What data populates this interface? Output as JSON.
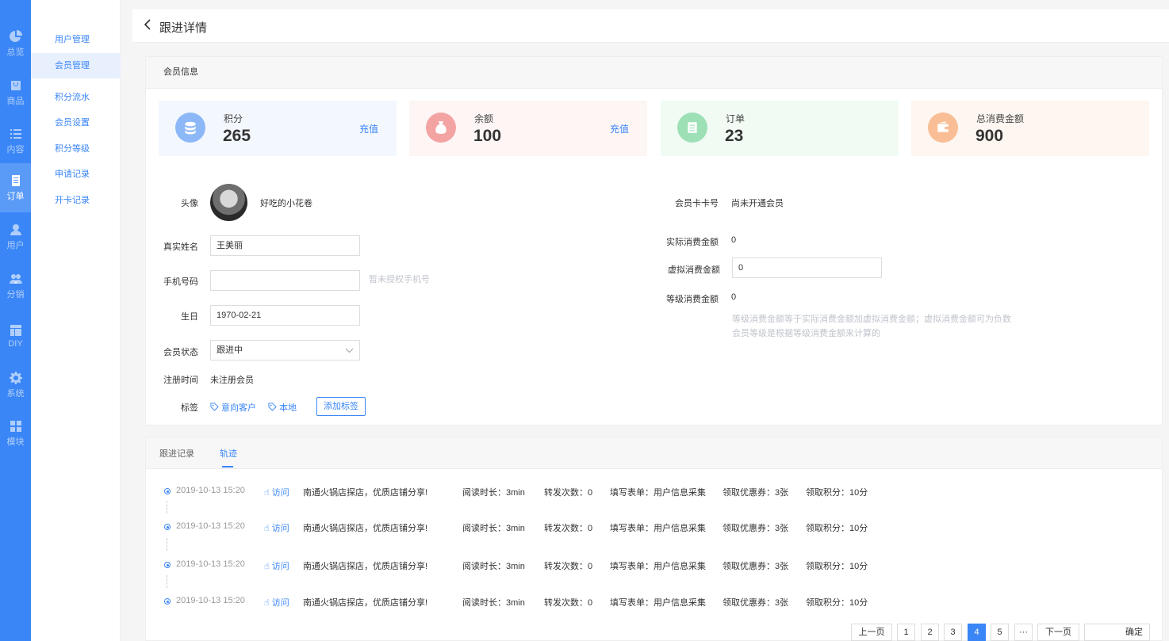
{
  "rail": [
    {
      "label": "总览",
      "icon": "pie-chart-icon"
    },
    {
      "label": "商品",
      "icon": "bag-icon"
    },
    {
      "label": "内容",
      "icon": "list-icon"
    },
    {
      "label": "订单",
      "icon": "document-icon"
    },
    {
      "label": "用户",
      "icon": "user-icon"
    },
    {
      "label": "分销",
      "icon": "group-icon"
    },
    {
      "label": "DIY",
      "icon": "layout-icon"
    },
    {
      "label": "系统",
      "icon": "gear-icon"
    },
    {
      "label": "模块",
      "icon": "grid-icon"
    }
  ],
  "subnav": [
    "用户管理",
    "会员管理",
    "积分流水",
    "会员设置",
    "积分等级",
    "申请记录",
    "开卡记录"
  ],
  "header": {
    "title": "跟进详情"
  },
  "member": {
    "section_title": "会员信息",
    "stats": [
      {
        "label": "积分",
        "value": "265",
        "action": "充值"
      },
      {
        "label": "余额",
        "value": "100",
        "action": "充值"
      },
      {
        "label": "订单",
        "value": "23"
      },
      {
        "label": "总消费金额",
        "value": "900"
      }
    ],
    "colors": {
      "points": "#6aa0f5",
      "balance": "#f08a8a",
      "orders": "#7ed3a0",
      "total": "#f7a971"
    },
    "avatar_label": "头像",
    "nickname": "好吃的小花卷",
    "real_name_label": "真实姓名",
    "real_name": "王美丽",
    "phone_label": "手机号码",
    "phone": "",
    "phone_hint": "暂未授权手机号",
    "birthday_label": "生日",
    "birthday": "1970-02-21",
    "status_label": "会员状态",
    "status": "跟进中",
    "register_label": "注册时间",
    "register": "未注册会员",
    "tags_label": "标签",
    "tags": [
      "意向客户",
      "本地"
    ],
    "add_tag": "添加标签",
    "card_no_label": "会员卡卡号",
    "card_no": "尚未开通会员",
    "actual_label": "实际消费金额",
    "actual": "0",
    "virtual_label": "虚拟消费金额",
    "virtual": "0",
    "level_label": "等级消费金额",
    "level": "0",
    "level_hint1": "等级消费金额等于实际消费金额加虚拟消费金额；虚拟消费金额可为负数",
    "level_hint2": "会员等级是根据等级消费金额来计算的"
  },
  "tabs": [
    "跟进记录",
    "轨迹"
  ],
  "timeline": [
    {
      "time": "2019-10-13 15:20",
      "type": "访问",
      "title": "南通火锅店探店，优质店铺分享!",
      "read": "阅读时长：3min",
      "share": "转发次数：0",
      "form": "填写表单：用户信息采集",
      "coupon": "领取优惠券：3张",
      "points": "领取积分：10分"
    },
    {
      "time": "2019-10-13 15:20",
      "type": "访问",
      "title": "南通火锅店探店，优质店铺分享!",
      "read": "阅读时长：3min",
      "share": "转发次数：0",
      "form": "填写表单：用户信息采集",
      "coupon": "领取优惠券：3张",
      "points": "领取积分：10分"
    },
    {
      "time": "2019-10-13 15:20",
      "type": "访问",
      "title": "南通火锅店探店，优质店铺分享!",
      "read": "阅读时长：3min",
      "share": "转发次数：0",
      "form": "填写表单：用户信息采集",
      "coupon": "领取优惠券：3张",
      "points": "领取积分：10分"
    },
    {
      "time": "2019-10-13 15:20",
      "type": "访问",
      "title": "南通火锅店探店，优质店铺分享!",
      "read": "阅读时长：3min",
      "share": "转发次数：0",
      "form": "填写表单：用户信息采集",
      "coupon": "领取优惠券：3张",
      "points": "领取积分：10分"
    }
  ],
  "pager": {
    "prev": "上一页",
    "pages": [
      "1",
      "2",
      "3",
      "4",
      "5"
    ],
    "current": "4",
    "ellipsis": "···",
    "next": "下一页",
    "jump": "",
    "confirm": "确定"
  }
}
